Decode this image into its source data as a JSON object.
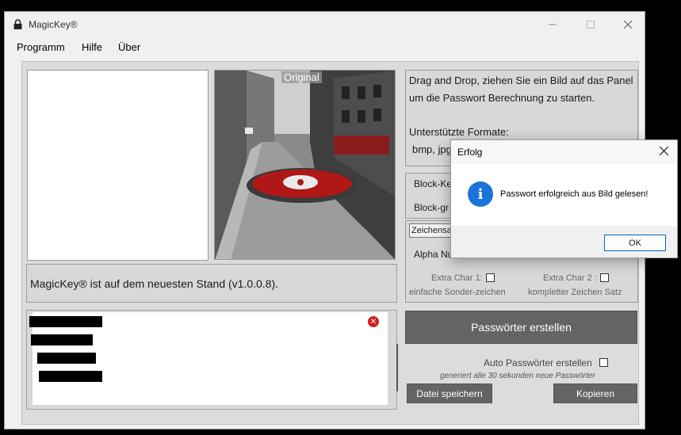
{
  "window": {
    "title": "MagicKey®"
  },
  "menu": [
    "Programm",
    "Hilfe",
    "Über"
  ],
  "image": {
    "label": "Original"
  },
  "status": {
    "text": "MagicKey® ist auf dem neuesten Stand (v1.0.0.8)."
  },
  "info": {
    "line1": "Drag and Drop, ziehen Sie ein  Bild auf das Panel",
    "line2": "um die Passwort Berechnung zu starten.",
    "formats_label": "Unterstützte Formate:",
    "formats": "bmp,  jpg"
  },
  "block": {
    "row1": "Block-Ke",
    "row2": "Block-gr"
  },
  "charset": {
    "selected": "Zeichensatz",
    "alpha": "Alpha Num",
    "extra1_label": "Extra Char 1:",
    "extra1_note": "einfache Sonder-zeichen",
    "extra2_label": "Extra Char 2 :",
    "extra2_note": "kompletter Zeichen Satz"
  },
  "actions": {
    "generate": "Passwörter erstellen",
    "auto_label": "Auto Passwörter erstellen",
    "auto_note": "generiert alle 30 sekunden neue Passwörter",
    "save": "Datei speichern",
    "copy": "Kopieren"
  },
  "dialog": {
    "title": "Erfolg",
    "message": "Passwort erfolgreich aus Bild gelesen!",
    "ok": "OK"
  },
  "colors": {
    "button": "#646464",
    "info_icon": "#1a73d8",
    "error_icon": "#d32020",
    "accent": "#0067c0"
  }
}
